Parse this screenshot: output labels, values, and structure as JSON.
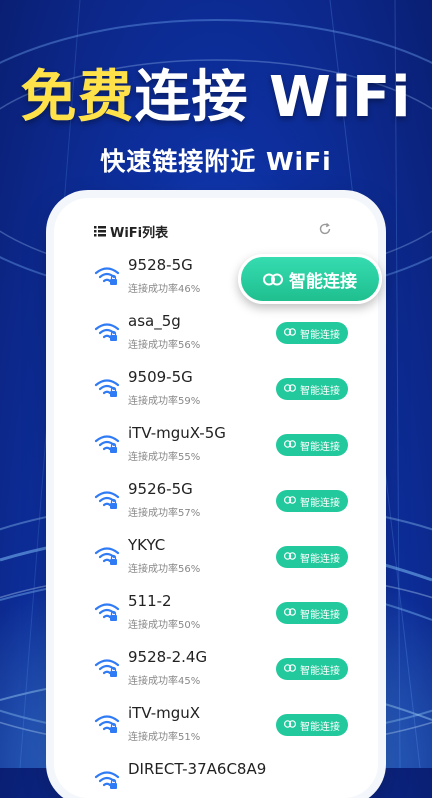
{
  "headline": {
    "highlight": "免费",
    "rest": "连接 WiFi"
  },
  "subheadline": "快速链接附近 WiFi",
  "list": {
    "title": "WiFi列表",
    "connect_label": "智能连接",
    "rate_prefix": "连接成功率",
    "items": [
      {
        "ssid": "9528-5G",
        "rate": "连接成功率46%"
      },
      {
        "ssid": "asa_5g",
        "rate": "连接成功率56%"
      },
      {
        "ssid": "9509-5G",
        "rate": "连接成功率59%"
      },
      {
        "ssid": "iTV-mguX-5G",
        "rate": "连接成功率55%"
      },
      {
        "ssid": "9526-5G",
        "rate": "连接成功率57%"
      },
      {
        "ssid": "YKYC",
        "rate": "连接成功率56%"
      },
      {
        "ssid": "511-2",
        "rate": "连接成功率50%"
      },
      {
        "ssid": "9528-2.4G",
        "rate": "连接成功率45%"
      },
      {
        "ssid": "iTV-mguX",
        "rate": "连接成功率51%"
      },
      {
        "ssid": "DIRECT-37A6C8A9",
        "rate": ""
      }
    ]
  },
  "highlight_button": {
    "label": "智能连接"
  },
  "colors": {
    "accent": "#22c99c",
    "headline_highlight": "#ffe24a",
    "background": "#1a4fd6"
  }
}
